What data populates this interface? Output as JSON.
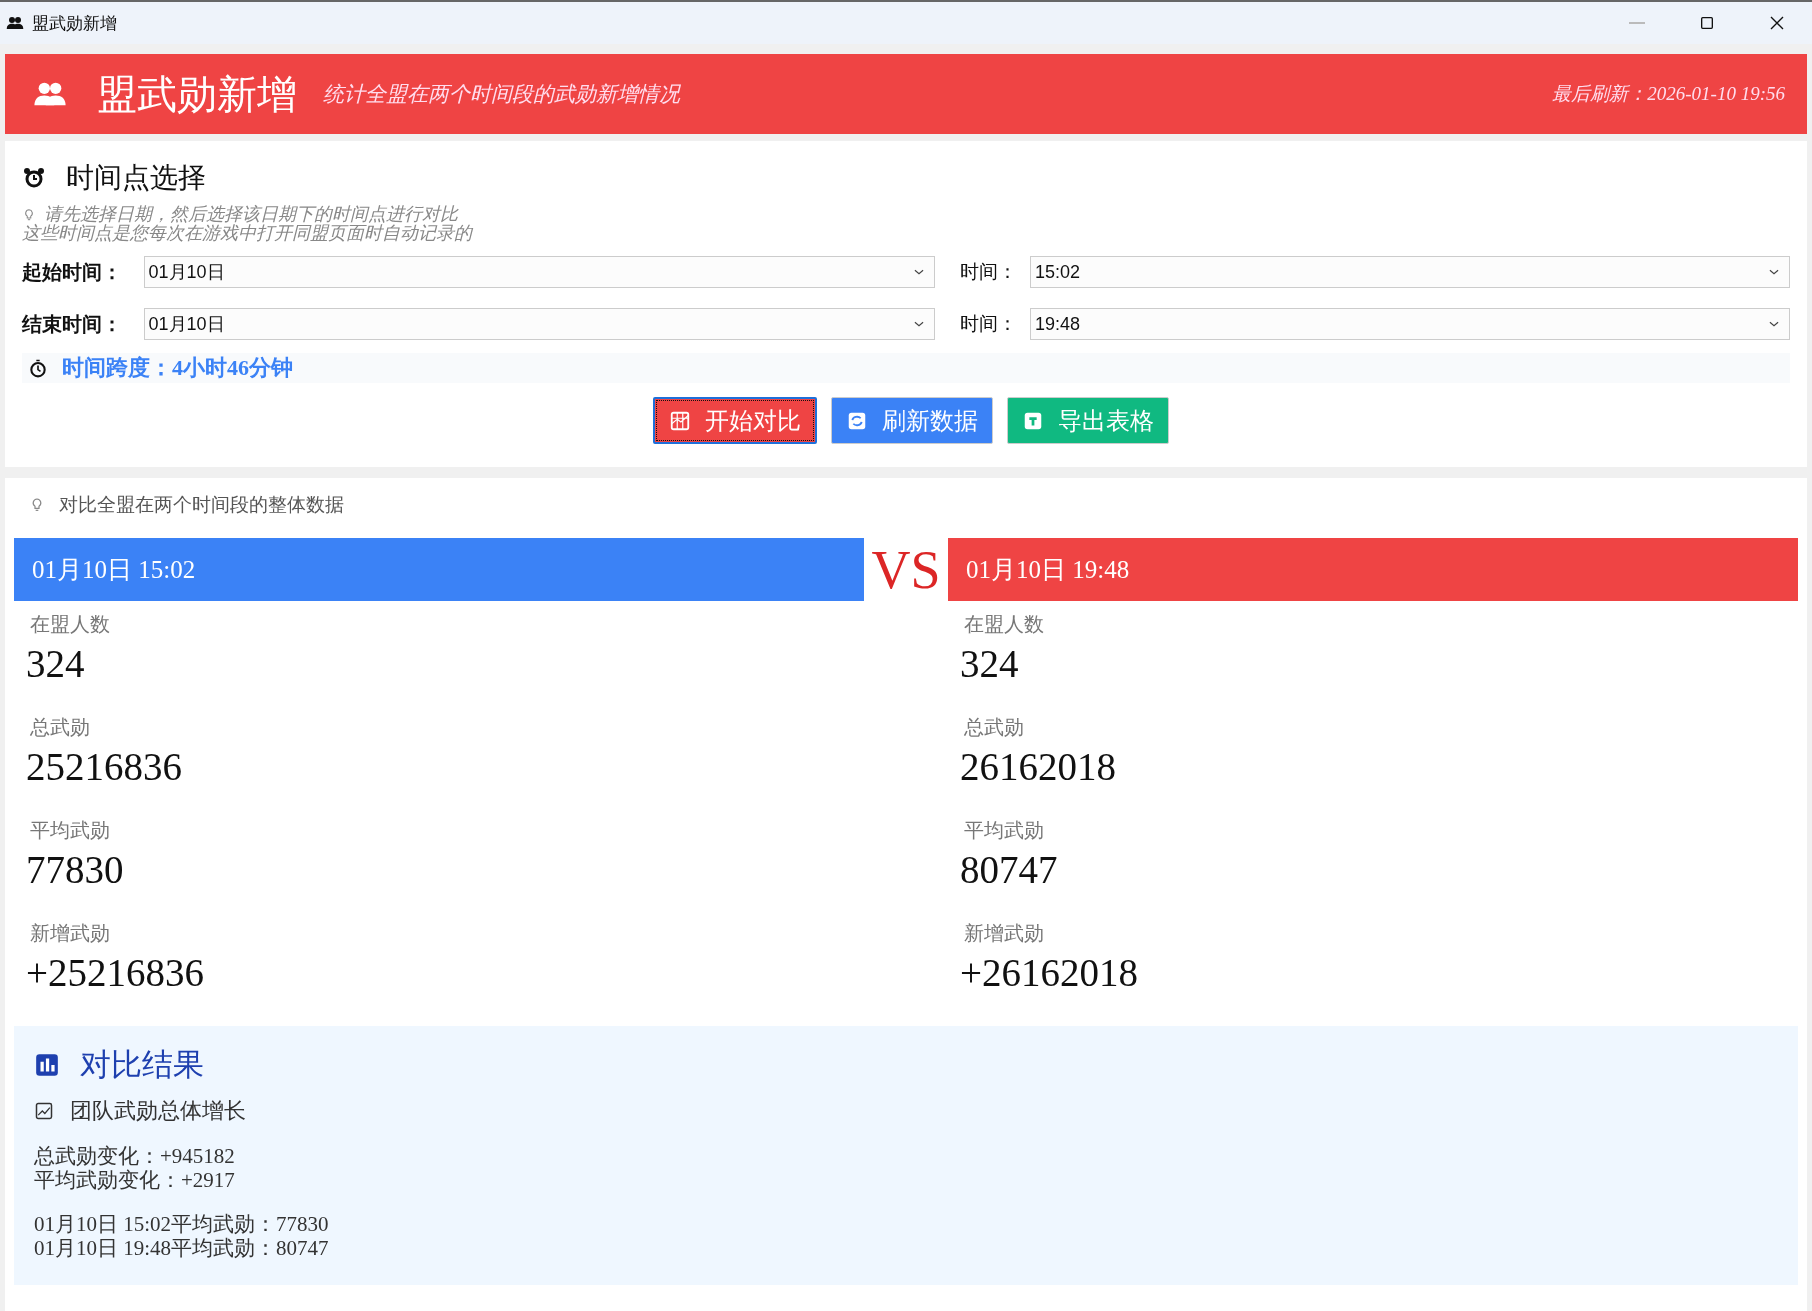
{
  "window": {
    "title": "盟武勋新增",
    "minimize_disabled": true
  },
  "header": {
    "title": "盟武勋新增",
    "subtitle": "统计全盟在两个时间段的武勋新增情况",
    "last_refresh": "最后刷新：2026-01-10 19:56"
  },
  "time_selection": {
    "heading": "时间点选择",
    "hints": [
      "请先选择日期，然后选择该日期下的时间点进行对比",
      "这些时间点是您每次在游戏中打开同盟页面时自动记录的"
    ],
    "rows": [
      {
        "label": "起始时间：",
        "date": "01月10日",
        "time_label": "时间：",
        "time": "15:02"
      },
      {
        "label": "结束时间：",
        "date": "01月10日",
        "time_label": "时间：",
        "time": "19:48"
      }
    ],
    "span": "时间跨度：4小时46分钟",
    "buttons": [
      {
        "label": "开始对比",
        "kind": "compare",
        "focused": true
      },
      {
        "label": "刷新数据",
        "kind": "refresh",
        "focused": false
      },
      {
        "label": "导出表格",
        "kind": "export",
        "focused": false
      }
    ]
  },
  "overview": {
    "hint": "对比全盟在两个时间段的整体数据",
    "vs": "VS",
    "sides": [
      {
        "title": "01月10日  15:02",
        "color": "#3b82f6",
        "stats": [
          {
            "label": "在盟人数",
            "value": "324"
          },
          {
            "label": "总武勋",
            "value": "25216836"
          },
          {
            "label": "平均武勋",
            "value": "77830"
          },
          {
            "label": "新增武勋",
            "value": "+25216836"
          }
        ]
      },
      {
        "title": "01月10日  19:48",
        "color": "#ef4444",
        "stats": [
          {
            "label": "在盟人数",
            "value": "324"
          },
          {
            "label": "总武勋",
            "value": "26162018"
          },
          {
            "label": "平均武勋",
            "value": "80747"
          },
          {
            "label": "新增武勋",
            "value": "+26162018"
          }
        ]
      }
    ]
  },
  "results": {
    "title": "对比结果",
    "subtitle": "团队武勋总体增长",
    "groups": [
      [
        "总武勋变化：+945182",
        "平均武勋变化：+2917"
      ],
      [
        "01月10日 15:02平均武勋：77830",
        "01月10日 19:48平均武勋：80747"
      ]
    ]
  }
}
